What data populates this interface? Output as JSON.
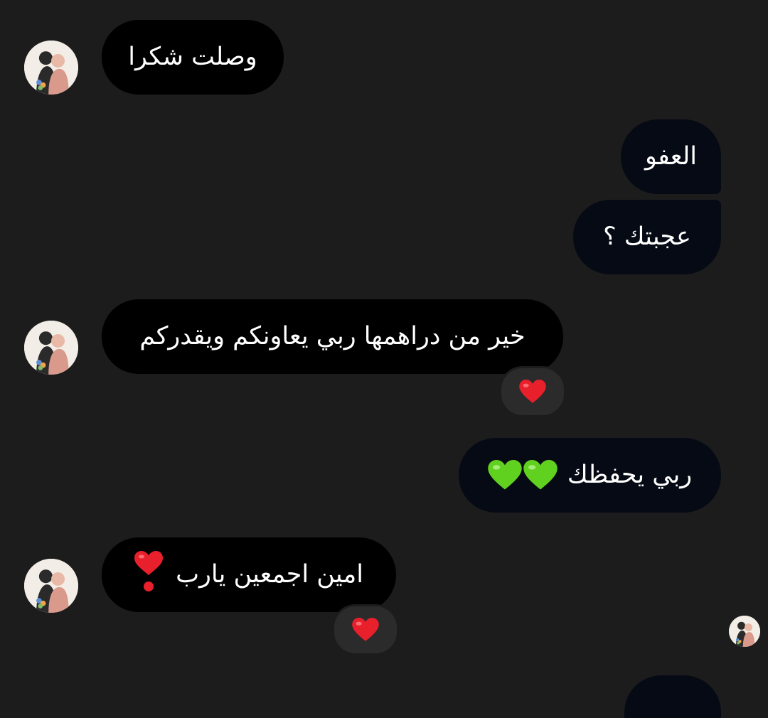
{
  "messages": [
    {
      "side": "incoming",
      "text": "وصلت شكرا"
    },
    {
      "side": "outgoing",
      "text": "العفو"
    },
    {
      "side": "outgoing",
      "text": "عجبتك ؟"
    },
    {
      "side": "incoming",
      "text": "خير من دراهمها ربي يعاونكم ويقدركم",
      "reaction": "red-heart"
    },
    {
      "side": "outgoing",
      "text": "ربي يحفظك",
      "emoji": "green-heart x2"
    },
    {
      "side": "incoming",
      "text": "امين اجمعين يارب",
      "emoji": "heavy-heart-exclamation",
      "reaction": "red-heart"
    }
  ],
  "colors": {
    "background": "#1c1c1c",
    "bubble_incoming": "#000000",
    "bubble_outgoing": "#050a14",
    "reaction_bg": "#2b2b2b",
    "heart_red": "#e8202c",
    "heart_green": "#5fd11e"
  }
}
